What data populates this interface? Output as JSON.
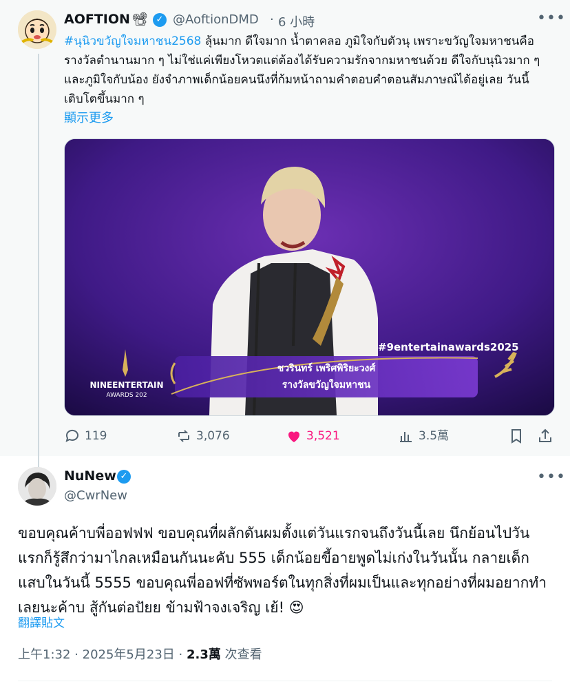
{
  "quoted_tweet": {
    "author_name": "AOFTION",
    "author_emoji": "📽",
    "handle": "@AoftionDMD",
    "separator": "·",
    "time_ago": "6 小時",
    "hashtag": "#นุนิวขวัญใจมหาชน2568",
    "text": " ลุ้นมาก ดีใจมาก น้ำตาคลอ ภูมิใจกับตัวนุ เพราะขวัญใจมหาชนคือรางวัลตำนานมาก ๆ ไม่ใช่แค่เพียงโหวตแต่ต้องได้รับความรักจากมหาชนด้วย ดีใจกับนุนิวมาก ๆ และภูมิใจกับน้อง ยังจำภาพเด็กน้อยคนนึงที่ก้มหน้าถามคำตอบคำตอนสัมภาษณ์ได้อยู่เลย วันนี้เติบโตขึ้นมาก ๆ",
    "show_more": "顯示更多",
    "image": {
      "hashtag_overlay": "#9entertainawards2025",
      "nameplate_name": "ชวรินทร์ เพริศพิริยะวงศ์",
      "nameplate_award": "รางวัลขวัญใจมหาชน",
      "logo_line1": "NINEENTERTAIN",
      "logo_line2": "AWARDS 202"
    },
    "stats": {
      "replies": "119",
      "reposts": "3,076",
      "likes": "3,521",
      "views": "3.5萬"
    }
  },
  "reply_tweet": {
    "author_name": "NuNew",
    "handle": "@CwrNew",
    "text": "ขอบคุณค้าบพี่ออฟฟฟ ขอบคุณที่ผลักดันผมตั้งแต่วันแรกจนถึงวันนี้เลย นึกย้อนไปวันแรกก็รู้สึกว่ามาไกลเหมือนกันนะคับ 555 เด็กน้อยขี้อายพูดไม่เก่งในวันนั้น กลายเด็กแสบในวันนี้ 5555 ขอบคุณพี่ออฟที่ซัพพอร์ตในทุกสิ่งที่ผมเป็นและทุกอย่างที่ผมอยากทำเลยนะค้าบ สู้กันต่อปัยย ข้ามฟ้าจงเจริญ เย้! 😍",
    "translate": "翻譯貼文",
    "time": "上午1:32",
    "date": "2025年5月23日",
    "dot": "·",
    "views": "2.3萬",
    "views_label": "次查看"
  },
  "colors": {
    "accent": "#1d9bf0",
    "like": "#f91880",
    "muted": "#536471",
    "quoted_bg": "#f7f9f9",
    "stage_purple": "#3a1a78",
    "gold": "#d8b25a"
  }
}
